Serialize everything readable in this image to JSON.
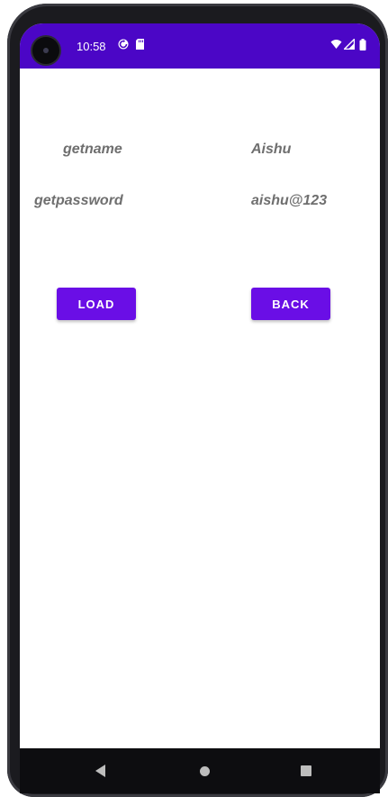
{
  "status_bar": {
    "time": "10:58",
    "icons": [
      "camera-icon",
      "sync-icon",
      "sd-card-icon",
      "wifi-icon",
      "signal-icon",
      "battery-icon"
    ],
    "color": "#4b06c6"
  },
  "form": {
    "name_label": "getname",
    "name_value": "Aishu",
    "password_label": "getpassword",
    "password_value": "aishu@123"
  },
  "buttons": {
    "load_label": "LOAD",
    "back_label": "BACK",
    "color": "#6a0ee6"
  },
  "nav_bar": {
    "icons": [
      "back-icon",
      "home-icon",
      "recents-icon"
    ]
  }
}
